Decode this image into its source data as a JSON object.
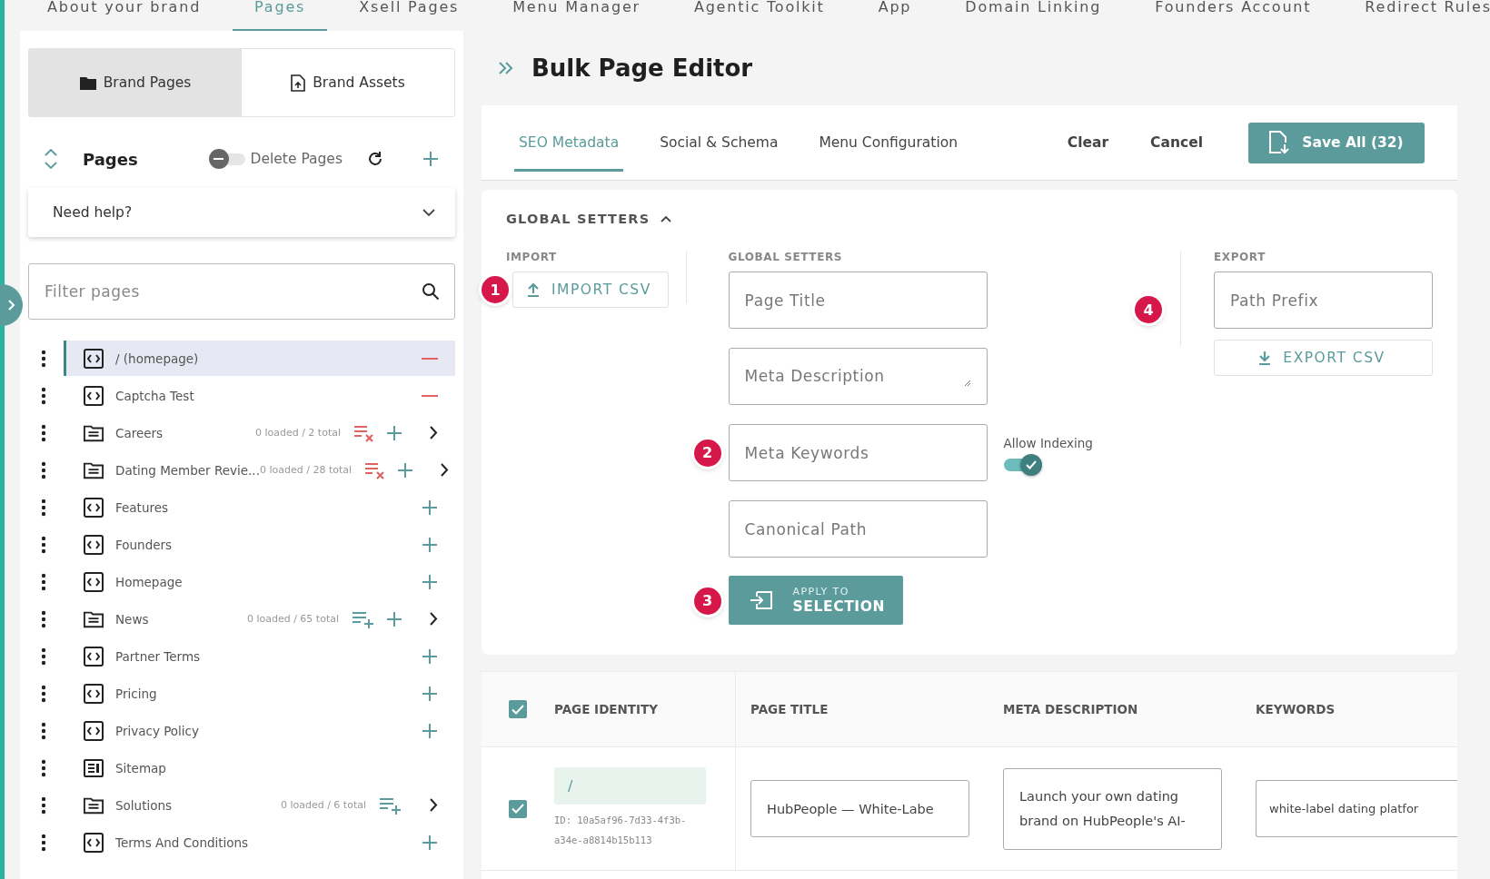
{
  "nav_tabs": [
    {
      "label": "About your brand",
      "selected": false
    },
    {
      "label": "Pages",
      "selected": true
    },
    {
      "label": "Xsell Pages",
      "selected": false
    },
    {
      "label": "Menu Manager",
      "selected": false
    },
    {
      "label": "Agentic Toolkit",
      "selected": false
    },
    {
      "label": "App",
      "selected": false
    },
    {
      "label": "Domain Linking",
      "selected": false
    },
    {
      "label": "Founders Account",
      "selected": false
    },
    {
      "label": "Redirect Rules",
      "selected": false
    }
  ],
  "sidebar": {
    "brand_tabs": [
      {
        "label": "Brand Pages",
        "kind": "folder",
        "selected": true
      },
      {
        "label": "Brand Assets",
        "kind": "file",
        "selected": false
      }
    ],
    "pages_title": "Pages",
    "delete_toggle": {
      "label": "Delete Pages",
      "on": false
    },
    "help": {
      "label": "Need help?",
      "expanded": false
    },
    "filter": {
      "placeholder": "Filter pages"
    },
    "items": [
      {
        "label": "/ (homepage)",
        "kind": "page",
        "selected": true,
        "remove": true
      },
      {
        "label": "Captcha Test",
        "kind": "page",
        "selected": false,
        "remove": true
      },
      {
        "label": "Careers",
        "kind": "folder",
        "selected": false,
        "count": "0 loaded / 2 total",
        "clear_list": true,
        "add": true,
        "expandable": true
      },
      {
        "label": "Dating Member Revie...",
        "kind": "folder",
        "selected": false,
        "count": "0 loaded / 28 total",
        "clear_list": true,
        "add": true,
        "expandable": true
      },
      {
        "label": "Features",
        "kind": "page",
        "selected": false,
        "add": true
      },
      {
        "label": "Founders",
        "kind": "page",
        "selected": false,
        "add": true
      },
      {
        "label": "Homepage",
        "kind": "page",
        "selected": false,
        "add": true
      },
      {
        "label": "News",
        "kind": "folder",
        "selected": false,
        "count": "0 loaded / 65 total",
        "load_list": true,
        "add": true,
        "expandable": true
      },
      {
        "label": "Partner Terms",
        "kind": "page",
        "selected": false,
        "add": true
      },
      {
        "label": "Pricing",
        "kind": "page",
        "selected": false,
        "add": true
      },
      {
        "label": "Privacy Policy",
        "kind": "page",
        "selected": false,
        "add": true
      },
      {
        "label": "Sitemap",
        "kind": "sitemap",
        "selected": false
      },
      {
        "label": "Solutions",
        "kind": "folder",
        "selected": false,
        "count": "0 loaded / 6 total",
        "load_list": true,
        "expandable": true
      },
      {
        "label": "Terms And Conditions",
        "kind": "page",
        "selected": false,
        "add": true
      }
    ]
  },
  "editor": {
    "title": "Bulk Page Editor",
    "tabs": [
      {
        "label": "SEO Metadata",
        "selected": true
      },
      {
        "label": "Social & Schema",
        "selected": false
      },
      {
        "label": "Menu Configuration",
        "selected": false
      }
    ],
    "actions": {
      "clear": "Clear",
      "cancel": "Cancel",
      "save": "Save All (32)"
    },
    "global_setters": {
      "title": "GLOBAL SETTERS",
      "expanded": true,
      "import": {
        "heading": "IMPORT",
        "button": "IMPORT CSV",
        "badge": "1"
      },
      "setters": {
        "heading": "GLOBAL SETTERS",
        "page_title": {
          "placeholder": "Page Title"
        },
        "meta_description": {
          "placeholder": "Meta Description"
        },
        "meta_keywords": {
          "placeholder": "Meta Keywords"
        },
        "keywords_badge": "2",
        "canonical_path": {
          "placeholder": "Canonical Path"
        },
        "allow_indexing": {
          "label": "Allow Indexing",
          "on": true
        },
        "apply_small": "APPLY TO",
        "apply_big": "SELECTION",
        "apply_badge": "3"
      },
      "export": {
        "heading": "EXPORT",
        "badge": "4",
        "path_prefix": {
          "placeholder": "Path Prefix"
        },
        "button": "EXPORT CSV"
      }
    },
    "table": {
      "all_checked": true,
      "columns": [
        "PAGE IDENTITY",
        "PAGE TITLE",
        "META DESCRIPTION",
        "KEYWORDS"
      ],
      "rows": [
        {
          "checked": true,
          "path": "/",
          "id": "ID: 10a5af96-7d33-4f3b-a34e-a8814b15b113",
          "page_title": "HubPeople — White-Labe",
          "meta_description": "Launch your own dating brand on HubPeople's AI-",
          "keywords": "white-label dating platfor"
        }
      ]
    }
  }
}
